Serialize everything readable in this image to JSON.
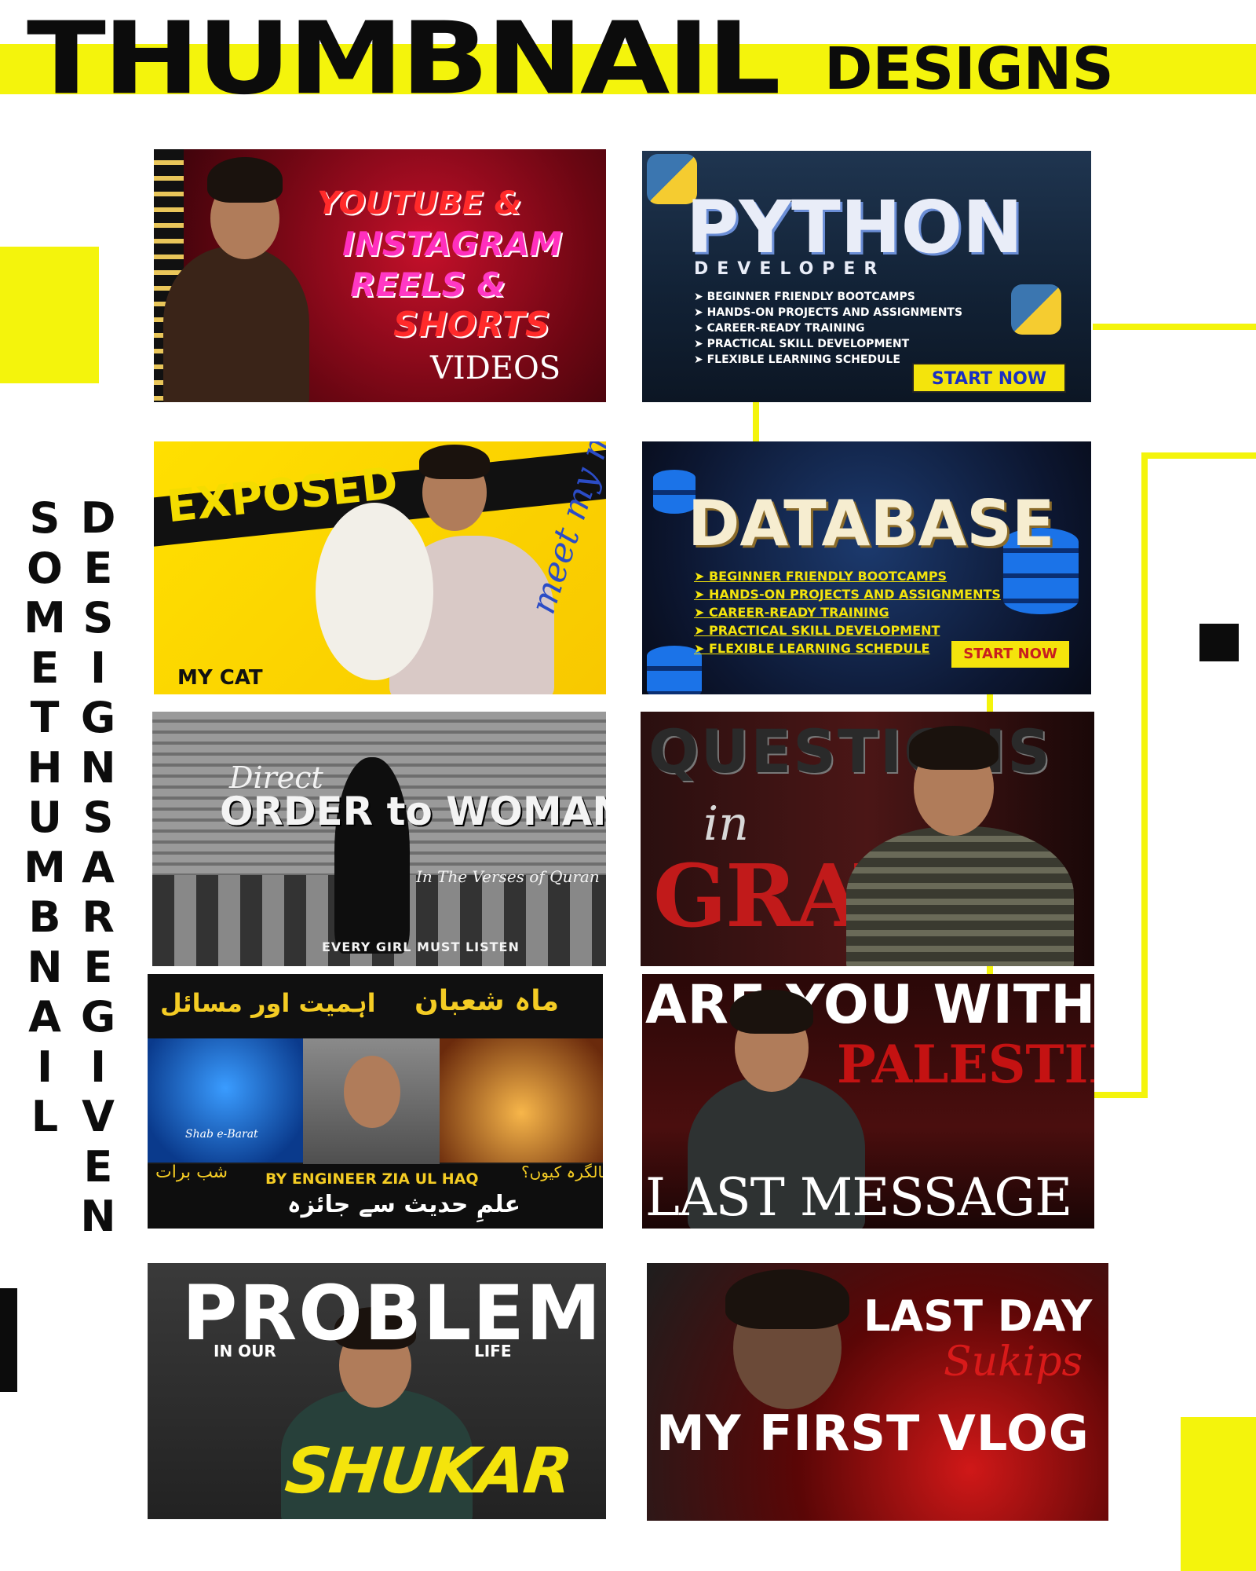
{
  "header": {
    "title": "THUMBNAIL",
    "subtitle": "DESIGNS"
  },
  "side_text": {
    "col1": [
      "S",
      "O",
      "M",
      "E",
      "T",
      "H",
      "U",
      "M",
      "B",
      "N",
      "A",
      "I",
      "L"
    ],
    "col2": [
      "D",
      "E",
      "S",
      "I",
      "G",
      "N",
      "S",
      "A",
      "R",
      "E",
      "G",
      "I",
      "V",
      "E",
      "N"
    ]
  },
  "colors": {
    "accent_yellow": "#f4f40c",
    "black": "#0c0c0c",
    "background": "#ffffff"
  },
  "thumbnails": [
    {
      "lines": [
        "YOUTUBE &",
        "INSTAGRAM",
        "REELS &",
        "SHORTS",
        "VIDEOS"
      ]
    },
    {
      "title": "PYTHON",
      "subtitle": "DEVELOPER",
      "bullets": [
        "➤ BEGINNER FRIENDLY BOOTCAMPS",
        "➤ HANDS-ON PROJECTS AND ASSIGNMENTS",
        "➤ CAREER-READY TRAINING",
        "➤ PRACTICAL SKILL DEVELOPMENT",
        "➤ FLEXIBLE LEARNING SCHEDULE"
      ],
      "cta": "START NOW"
    },
    {
      "title": "EXPOSED",
      "caption": "MY CAT",
      "script": "meet my mau"
    },
    {
      "title": "DATABASE",
      "bullets": [
        "➤ BEGINNER FRIENDLY BOOTCAMPS",
        "➤ HANDS-ON PROJECTS AND ASSIGNMENTS",
        "➤ CAREER-READY TRAINING",
        "➤ PRACTICAL SKILL DEVELOPMENT",
        "➤ FLEXIBLE LEARNING SCHEDULE"
      ],
      "cta": "START NOW"
    },
    {
      "lines": [
        "Direct",
        "ORDER to WOMAN",
        "In The Verses of Quran",
        "EVERY GIRL MUST LISTEN"
      ]
    },
    {
      "lines": [
        "QUESTIONS",
        "in",
        "GRAVE"
      ]
    },
    {
      "urdu_title_right": "ماہ شعبان",
      "urdu_title_left": "اہمیت اور مسائل",
      "shab": "Shab e-Barat",
      "urdu_shab": "شب برات",
      "urdu_birthday": "سالگرہ کیوں؟",
      "byline": "BY  ENGINEER ZIA UL HAQ",
      "urdu_sub": "علمِ حدیث سے جائزہ"
    },
    {
      "lines": [
        "ARE YOU WITH",
        "PALESTINE",
        "LAST MESSAGE"
      ]
    },
    {
      "lines": [
        "PROBLEM",
        "IN OUR",
        "LIFE",
        "SHUKAR"
      ]
    },
    {
      "lines": [
        "LAST DAY",
        "Sukips",
        "MY FIRST VLOG"
      ]
    }
  ]
}
